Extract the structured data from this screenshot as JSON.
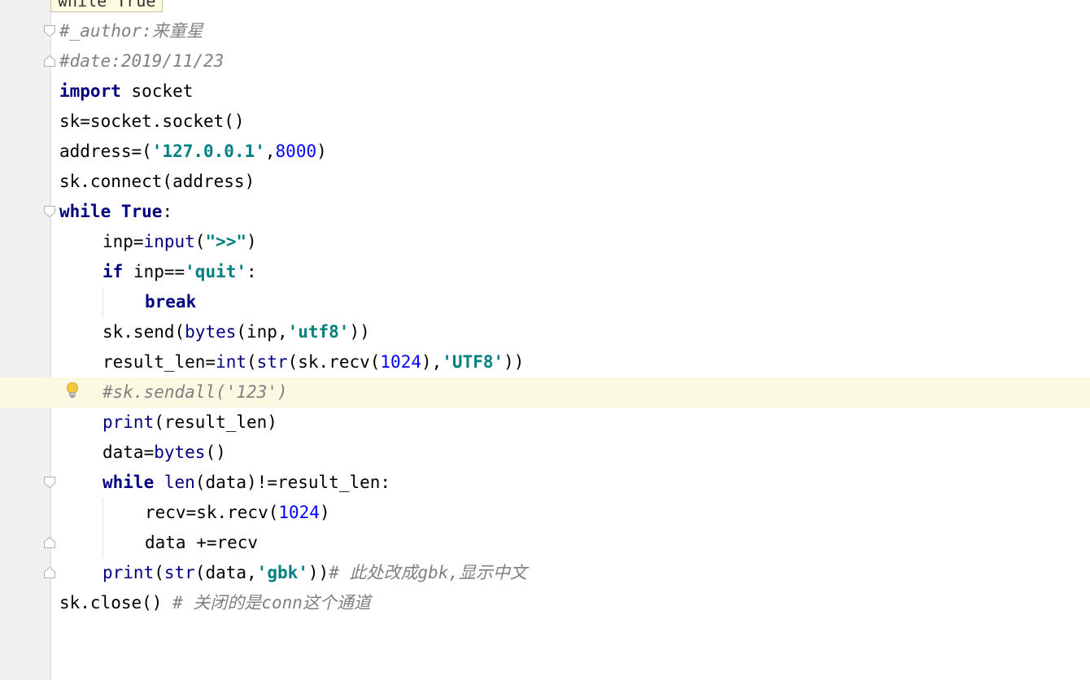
{
  "tooltip": "while True",
  "lines": {
    "l1": "#_author:来童星",
    "l2": "#date:2019/11/23",
    "l3_kw": "import",
    "l3_rest": " socket",
    "l4": "sk=socket.socket()",
    "l5_a": "address=(",
    "l5_str": "'127.0.0.1'",
    "l5_b": ",",
    "l5_num": "8000",
    "l5_c": ")",
    "l6": "sk.connect(address)",
    "l7_kw1": "while",
    "l7_sp": " ",
    "l7_kw2": "True",
    "l7_c": ":",
    "l8_a": "inp=",
    "l8_bi": "input",
    "l8_b": "(",
    "l8_str": "\">>\"",
    "l8_c": ")",
    "l9_kw": "if",
    "l9_a": " inp==",
    "l9_str": "'quit'",
    "l9_c": ":",
    "l10_kw": "break",
    "l11_a": "sk.send(",
    "l11_bi": "bytes",
    "l11_b": "(inp,",
    "l11_str": "'utf8'",
    "l11_c": "))",
    "l12_a": "result_len=",
    "l12_bi1": "int",
    "l12_b": "(",
    "l12_bi2": "str",
    "l12_c": "(sk.recv(",
    "l12_num": "1024",
    "l12_d": "),",
    "l12_str": "'UTF8'",
    "l12_e": "))",
    "l13": "#sk.sendall('123')",
    "l14_bi": "print",
    "l14_a": "(result_len)",
    "l15_a": "data=",
    "l15_bi": "bytes",
    "l15_b": "()",
    "l16_kw": "while",
    "l16_sp": " ",
    "l16_bi": "len",
    "l16_a": "(data)!=result_len:",
    "l17_a": "recv=sk.recv(",
    "l17_num": "1024",
    "l17_b": ")",
    "l18": "data +=recv",
    "l19_bi1": "print",
    "l19_a": "(",
    "l19_bi2": "str",
    "l19_b": "(data,",
    "l19_str": "'gbk'",
    "l19_c": "))",
    "l19_cmt": "# 此处改成gbk,显示中文",
    "l20_a": "sk.close() ",
    "l20_cmt": "# 关闭的是conn这个通道"
  },
  "icons": {
    "fold_marker": "fold-marker-icon",
    "intention": "lightbulb-icon"
  },
  "colors": {
    "keyword": "#000080",
    "string": "#008080",
    "number": "#0000ff",
    "comment": "#808080",
    "current_line": "#fcf9e3",
    "gutter": "#f0f0f0"
  }
}
